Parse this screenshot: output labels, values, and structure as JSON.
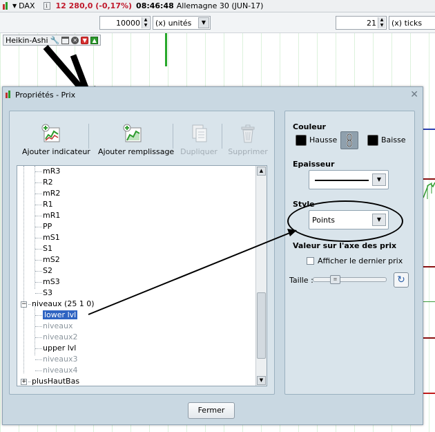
{
  "topbar": {
    "instrument": "DAX",
    "price": "12 280,0 (-0,17%)",
    "time": "08:46:48",
    "market": "Allemagne 30 (JUN-17)"
  },
  "toolbar": {
    "quantity_value": "10000",
    "quantity_unit": "(x) unités",
    "ticks_value": "21",
    "ticks_unit": "(x) ticks"
  },
  "chart": {
    "indicator_label": "Heikin-Ashi"
  },
  "dialog": {
    "title": "Propriétés - Prix",
    "tools": {
      "add_indicator": "Ajouter indicateur",
      "add_fill": "Ajouter remplissage",
      "duplicate": "Dupliquer",
      "delete": "Supprimer"
    },
    "tree": [
      {
        "label": "mR3",
        "state": "normal"
      },
      {
        "label": "R2",
        "state": "normal"
      },
      {
        "label": "mR2",
        "state": "normal"
      },
      {
        "label": "R1",
        "state": "normal"
      },
      {
        "label": "mR1",
        "state": "normal"
      },
      {
        "label": "PP",
        "state": "normal"
      },
      {
        "label": "mS1",
        "state": "normal"
      },
      {
        "label": "S1",
        "state": "normal"
      },
      {
        "label": "mS2",
        "state": "normal"
      },
      {
        "label": "S2",
        "state": "normal"
      },
      {
        "label": "mS3",
        "state": "normal"
      },
      {
        "label": "S3",
        "state": "normal"
      },
      {
        "label": "niveaux (25 1 0)",
        "state": "group"
      },
      {
        "label": "lower lvl",
        "state": "selected"
      },
      {
        "label": "niveaux",
        "state": "dim"
      },
      {
        "label": "niveaux2",
        "state": "dim"
      },
      {
        "label": "upper lvl",
        "state": "normal"
      },
      {
        "label": "niveaux3",
        "state": "dim"
      },
      {
        "label": "niveaux4",
        "state": "dim"
      },
      {
        "label": "plusHautBas",
        "state": "group"
      }
    ],
    "properties": {
      "couleur_label": "Couleur",
      "hausse_label": "Hausse",
      "baisse_label": "Baisse",
      "epaisseur_label": "Epaisseur",
      "style_label": "Style",
      "style_value": "Points",
      "axis_section_label": "Valeur sur l'axe des prix",
      "show_last_price_label": "Afficher le dernier prix",
      "taille_label": "Taille :"
    },
    "close_button": "Fermer"
  },
  "colors": {
    "price_down": "#c0192c",
    "selection": "#2f64c2",
    "dialog_bg": "#c9d8e2"
  }
}
